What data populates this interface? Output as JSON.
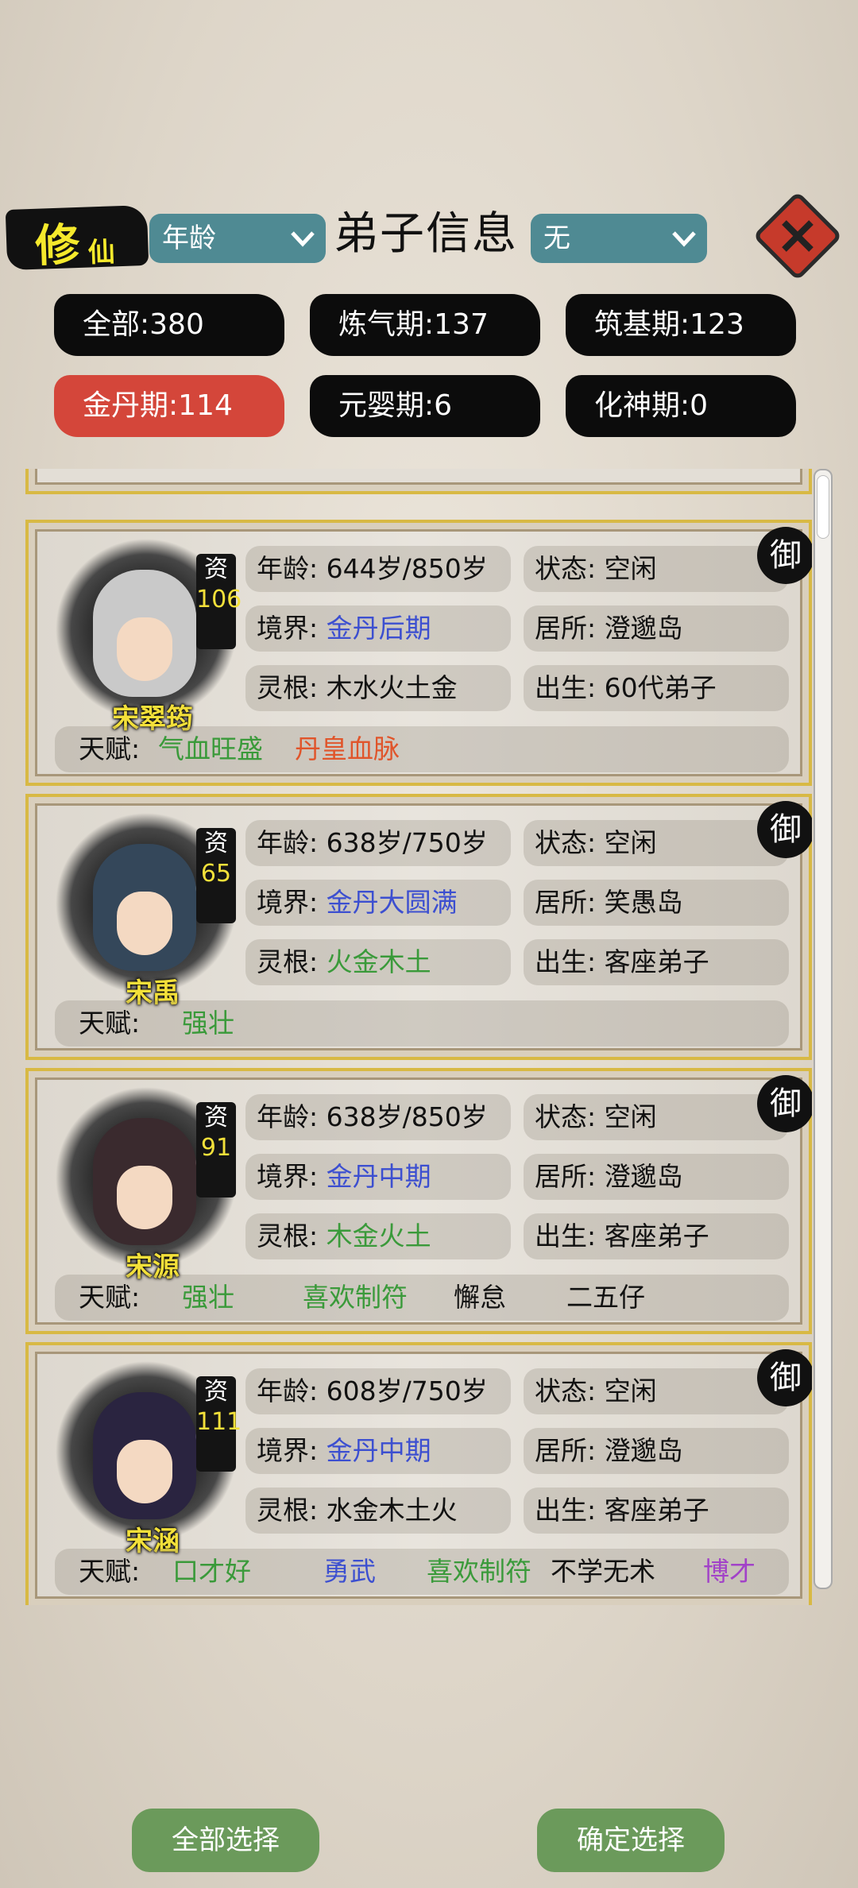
{
  "header": {
    "logo_big": "修",
    "logo_small": "仙",
    "sort_select": "年龄",
    "title": "弟子信息",
    "filter_select": "无"
  },
  "filters": [
    {
      "label": "全部:380",
      "active": false
    },
    {
      "label": "炼气期:137",
      "active": false
    },
    {
      "label": "筑基期:123",
      "active": false
    },
    {
      "label": "金丹期:114",
      "active": true
    },
    {
      "label": "元婴期:6",
      "active": false
    },
    {
      "label": "化神期:0",
      "active": false
    }
  ],
  "labels": {
    "age": "年龄:",
    "status": "状态:",
    "realm": "境界:",
    "residence": "居所:",
    "root": "灵根:",
    "birth": "出生:",
    "talent": "天赋:",
    "aptitude": "资",
    "seal": "御"
  },
  "disciples": [
    {
      "name": "宋翠筠",
      "aptitude": "106",
      "age": "644岁/850岁",
      "status": "空闲",
      "realm": "金丹后期",
      "residence": "澄邈岛",
      "root": "木水火土金",
      "birth": "60代弟子",
      "talents": [
        {
          "text": "气血旺盛",
          "color": "green"
        },
        {
          "text": "丹皇血脉",
          "color": "orange"
        }
      ]
    },
    {
      "name": "宋禹",
      "aptitude": "65",
      "age": "638岁/750岁",
      "status": "空闲",
      "realm": "金丹大圆满",
      "residence": "笑愚岛",
      "root": "火金木土",
      "birth": "客座弟子",
      "talents": [
        {
          "text": "强壮",
          "color": "green"
        }
      ]
    },
    {
      "name": "宋源",
      "aptitude": "91",
      "age": "638岁/850岁",
      "status": "空闲",
      "realm": "金丹中期",
      "residence": "澄邈岛",
      "root": "木金火土",
      "birth": "客座弟子",
      "talents": [
        {
          "text": "强壮",
          "color": "green"
        },
        {
          "text": "喜欢制符",
          "color": "green"
        },
        {
          "text": "懈怠",
          "color": "black"
        },
        {
          "text": "二五仔",
          "color": "black"
        }
      ]
    },
    {
      "name": "宋涵",
      "aptitude": "111",
      "age": "608岁/750岁",
      "status": "空闲",
      "realm": "金丹中期",
      "residence": "澄邈岛",
      "root": "水金木土火",
      "birth": "客座弟子",
      "talents": [
        {
          "text": "口才好",
          "color": "green"
        },
        {
          "text": "勇武",
          "color": "blue"
        },
        {
          "text": "喜欢制符",
          "color": "green"
        },
        {
          "text": "不学无术",
          "color": "black"
        },
        {
          "text": "博才",
          "color": "purple"
        }
      ]
    }
  ],
  "buttons": {
    "select_all": "全部选择",
    "confirm": "确定选择"
  }
}
